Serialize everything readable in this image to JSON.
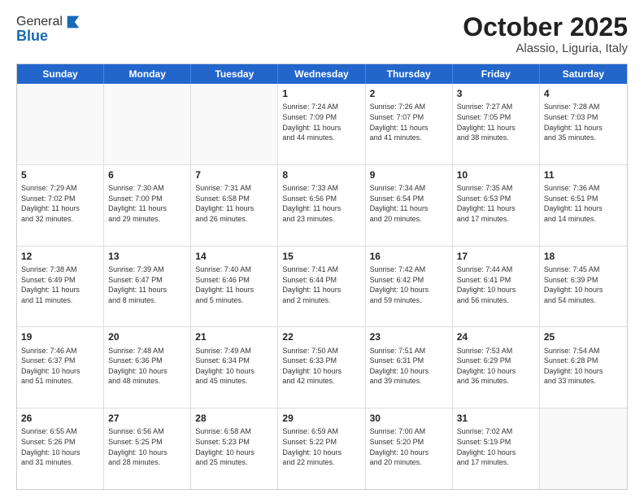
{
  "header": {
    "logo_line1": "General",
    "logo_line2": "Blue",
    "month": "October 2025",
    "location": "Alassio, Liguria, Italy"
  },
  "weekdays": [
    "Sunday",
    "Monday",
    "Tuesday",
    "Wednesday",
    "Thursday",
    "Friday",
    "Saturday"
  ],
  "rows": [
    [
      {
        "day": "",
        "info": ""
      },
      {
        "day": "",
        "info": ""
      },
      {
        "day": "",
        "info": ""
      },
      {
        "day": "1",
        "info": "Sunrise: 7:24 AM\nSunset: 7:09 PM\nDaylight: 11 hours\nand 44 minutes."
      },
      {
        "day": "2",
        "info": "Sunrise: 7:26 AM\nSunset: 7:07 PM\nDaylight: 11 hours\nand 41 minutes."
      },
      {
        "day": "3",
        "info": "Sunrise: 7:27 AM\nSunset: 7:05 PM\nDaylight: 11 hours\nand 38 minutes."
      },
      {
        "day": "4",
        "info": "Sunrise: 7:28 AM\nSunset: 7:03 PM\nDaylight: 11 hours\nand 35 minutes."
      }
    ],
    [
      {
        "day": "5",
        "info": "Sunrise: 7:29 AM\nSunset: 7:02 PM\nDaylight: 11 hours\nand 32 minutes."
      },
      {
        "day": "6",
        "info": "Sunrise: 7:30 AM\nSunset: 7:00 PM\nDaylight: 11 hours\nand 29 minutes."
      },
      {
        "day": "7",
        "info": "Sunrise: 7:31 AM\nSunset: 6:58 PM\nDaylight: 11 hours\nand 26 minutes."
      },
      {
        "day": "8",
        "info": "Sunrise: 7:33 AM\nSunset: 6:56 PM\nDaylight: 11 hours\nand 23 minutes."
      },
      {
        "day": "9",
        "info": "Sunrise: 7:34 AM\nSunset: 6:54 PM\nDaylight: 11 hours\nand 20 minutes."
      },
      {
        "day": "10",
        "info": "Sunrise: 7:35 AM\nSunset: 6:53 PM\nDaylight: 11 hours\nand 17 minutes."
      },
      {
        "day": "11",
        "info": "Sunrise: 7:36 AM\nSunset: 6:51 PM\nDaylight: 11 hours\nand 14 minutes."
      }
    ],
    [
      {
        "day": "12",
        "info": "Sunrise: 7:38 AM\nSunset: 6:49 PM\nDaylight: 11 hours\nand 11 minutes."
      },
      {
        "day": "13",
        "info": "Sunrise: 7:39 AM\nSunset: 6:47 PM\nDaylight: 11 hours\nand 8 minutes."
      },
      {
        "day": "14",
        "info": "Sunrise: 7:40 AM\nSunset: 6:46 PM\nDaylight: 11 hours\nand 5 minutes."
      },
      {
        "day": "15",
        "info": "Sunrise: 7:41 AM\nSunset: 6:44 PM\nDaylight: 11 hours\nand 2 minutes."
      },
      {
        "day": "16",
        "info": "Sunrise: 7:42 AM\nSunset: 6:42 PM\nDaylight: 10 hours\nand 59 minutes."
      },
      {
        "day": "17",
        "info": "Sunrise: 7:44 AM\nSunset: 6:41 PM\nDaylight: 10 hours\nand 56 minutes."
      },
      {
        "day": "18",
        "info": "Sunrise: 7:45 AM\nSunset: 6:39 PM\nDaylight: 10 hours\nand 54 minutes."
      }
    ],
    [
      {
        "day": "19",
        "info": "Sunrise: 7:46 AM\nSunset: 6:37 PM\nDaylight: 10 hours\nand 51 minutes."
      },
      {
        "day": "20",
        "info": "Sunrise: 7:48 AM\nSunset: 6:36 PM\nDaylight: 10 hours\nand 48 minutes."
      },
      {
        "day": "21",
        "info": "Sunrise: 7:49 AM\nSunset: 6:34 PM\nDaylight: 10 hours\nand 45 minutes."
      },
      {
        "day": "22",
        "info": "Sunrise: 7:50 AM\nSunset: 6:33 PM\nDaylight: 10 hours\nand 42 minutes."
      },
      {
        "day": "23",
        "info": "Sunrise: 7:51 AM\nSunset: 6:31 PM\nDaylight: 10 hours\nand 39 minutes."
      },
      {
        "day": "24",
        "info": "Sunrise: 7:53 AM\nSunset: 6:29 PM\nDaylight: 10 hours\nand 36 minutes."
      },
      {
        "day": "25",
        "info": "Sunrise: 7:54 AM\nSunset: 6:28 PM\nDaylight: 10 hours\nand 33 minutes."
      }
    ],
    [
      {
        "day": "26",
        "info": "Sunrise: 6:55 AM\nSunset: 5:26 PM\nDaylight: 10 hours\nand 31 minutes."
      },
      {
        "day": "27",
        "info": "Sunrise: 6:56 AM\nSunset: 5:25 PM\nDaylight: 10 hours\nand 28 minutes."
      },
      {
        "day": "28",
        "info": "Sunrise: 6:58 AM\nSunset: 5:23 PM\nDaylight: 10 hours\nand 25 minutes."
      },
      {
        "day": "29",
        "info": "Sunrise: 6:59 AM\nSunset: 5:22 PM\nDaylight: 10 hours\nand 22 minutes."
      },
      {
        "day": "30",
        "info": "Sunrise: 7:00 AM\nSunset: 5:20 PM\nDaylight: 10 hours\nand 20 minutes."
      },
      {
        "day": "31",
        "info": "Sunrise: 7:02 AM\nSunset: 5:19 PM\nDaylight: 10 hours\nand 17 minutes."
      },
      {
        "day": "",
        "info": ""
      }
    ]
  ]
}
